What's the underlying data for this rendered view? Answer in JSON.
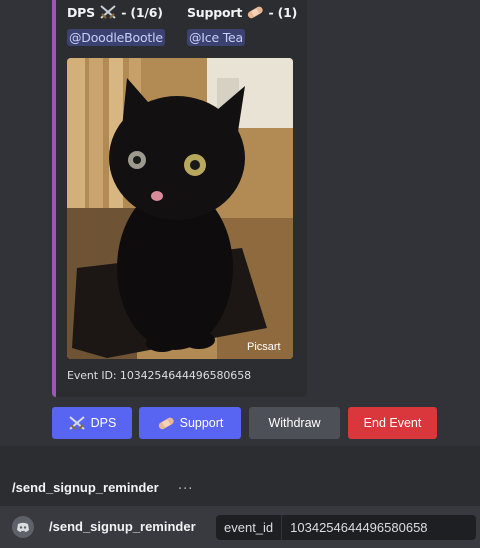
{
  "embed": {
    "accent_color": "#9b59b6",
    "fields": [
      {
        "name": "DPS",
        "emoji": "crossed-swords-icon",
        "count": "- (1/6)",
        "value": "@DoodleBootle"
      },
      {
        "name": "Support",
        "emoji": "bandage-icon",
        "count": "- (1)",
        "value": "@Ice Tea"
      }
    ],
    "image_alt": "black cat photo",
    "image_watermark": "Picsart",
    "footer": "Event ID: 1034254644496580658"
  },
  "buttons": {
    "dps": {
      "label": "DPS",
      "icon": "crossed-swords-icon",
      "color": "#5865f2"
    },
    "support": {
      "label": "Support",
      "icon": "bandage-icon",
      "color": "#5865f2"
    },
    "withdraw": {
      "label": "Withdraw",
      "color": "#4e5058"
    },
    "end_event": {
      "label": "End Event",
      "color": "#da373c"
    }
  },
  "autocomplete": {
    "command": "/send_signup_reminder",
    "ellipsis": "..."
  },
  "input": {
    "icon": "discord-icon",
    "command": "/send_signup_reminder",
    "option_name": "event_id",
    "option_value": "1034254644496580658"
  }
}
